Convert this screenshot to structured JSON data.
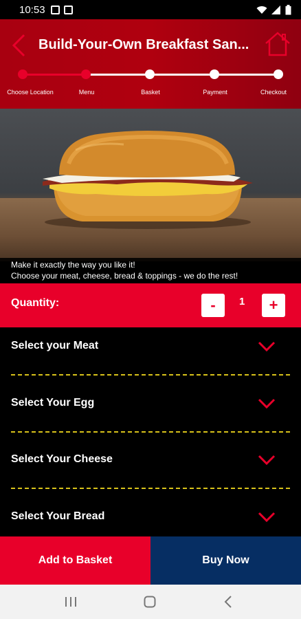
{
  "status_bar": {
    "time": "10:53"
  },
  "header": {
    "title": "Build-Your-Own Breakfast San...",
    "steps": [
      {
        "label": "Choose Location",
        "state": "done"
      },
      {
        "label": "Menu",
        "state": "done"
      },
      {
        "label": "Basket",
        "state": "todo"
      },
      {
        "label": "Payment",
        "state": "todo"
      },
      {
        "label": "Checkout",
        "state": "todo"
      }
    ]
  },
  "hero": {
    "caption_line1": "Make it exactly the way you like it!",
    "caption_line2": "Choose your meat, cheese, bread & toppings - we do the rest!"
  },
  "quantity": {
    "label": "Quantity:",
    "value": "1",
    "decrement_label": "-",
    "increment_label": "+"
  },
  "options": [
    {
      "label": "Select your Meat"
    },
    {
      "label": "Select Your Egg"
    },
    {
      "label": "Select Your Cheese"
    },
    {
      "label": "Select Your Bread"
    }
  ],
  "actions": {
    "add_to_basket": "Add to Basket",
    "buy_now": "Buy Now"
  },
  "colors": {
    "accent_red": "#e8002a",
    "header_red": "#b0000f",
    "navy": "#062e63",
    "divider_yellow": "#d8c21a"
  },
  "icons": {
    "back": "chevron-left-icon",
    "home": "home-icon",
    "expand": "chevron-down-icon",
    "nav_recents": "recents-icon",
    "nav_home": "nav-home-icon",
    "nav_back": "nav-back-icon"
  }
}
